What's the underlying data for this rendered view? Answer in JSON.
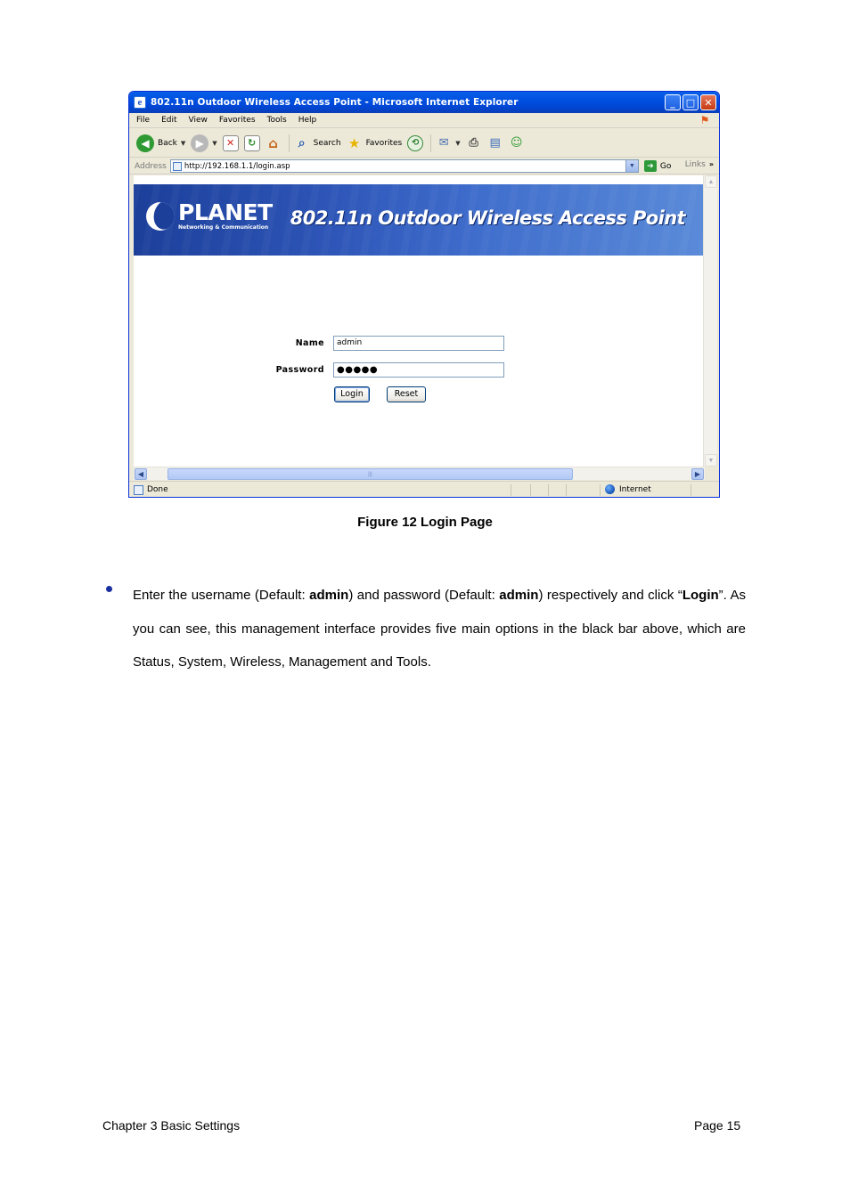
{
  "browser": {
    "title": "802.11n Outdoor Wireless Access Point - Microsoft Internet Explorer",
    "menu": [
      "File",
      "Edit",
      "View",
      "Favorites",
      "Tools",
      "Help"
    ],
    "toolbar": {
      "back": "Back",
      "search": "Search",
      "favorites": "Favorites"
    },
    "address_label": "Address",
    "url": "http://192.168.1.1/login.asp",
    "go": "Go",
    "links": "Links",
    "status": "Done",
    "zone": "Internet"
  },
  "page": {
    "brand": "PLANET",
    "brand_sub": "Networking & Communication",
    "banner_title": "802.11n Outdoor Wireless Access Point",
    "name_label": "Name",
    "name_value": "admin",
    "password_label": "Password",
    "password_value": "●●●●●",
    "login_label": "Login",
    "reset_label": "Reset"
  },
  "document": {
    "caption": "Figure 12 Login Page",
    "para_parts": [
      "Enter the username (Default: ",
      "admin",
      ") and password (Default: ",
      "admin",
      ") respectively and click “",
      "Login",
      "”. As you can see, this management interface provides five main options in the black bar above, which are Status, System, Wireless, Management and Tools."
    ],
    "footer_left": "Chapter 3 Basic Settings",
    "footer_right": "Page 15"
  },
  "colors": {
    "titlebar": "#0050e0",
    "banner": "#2e56b8",
    "bullet": "#1a2fa0"
  }
}
